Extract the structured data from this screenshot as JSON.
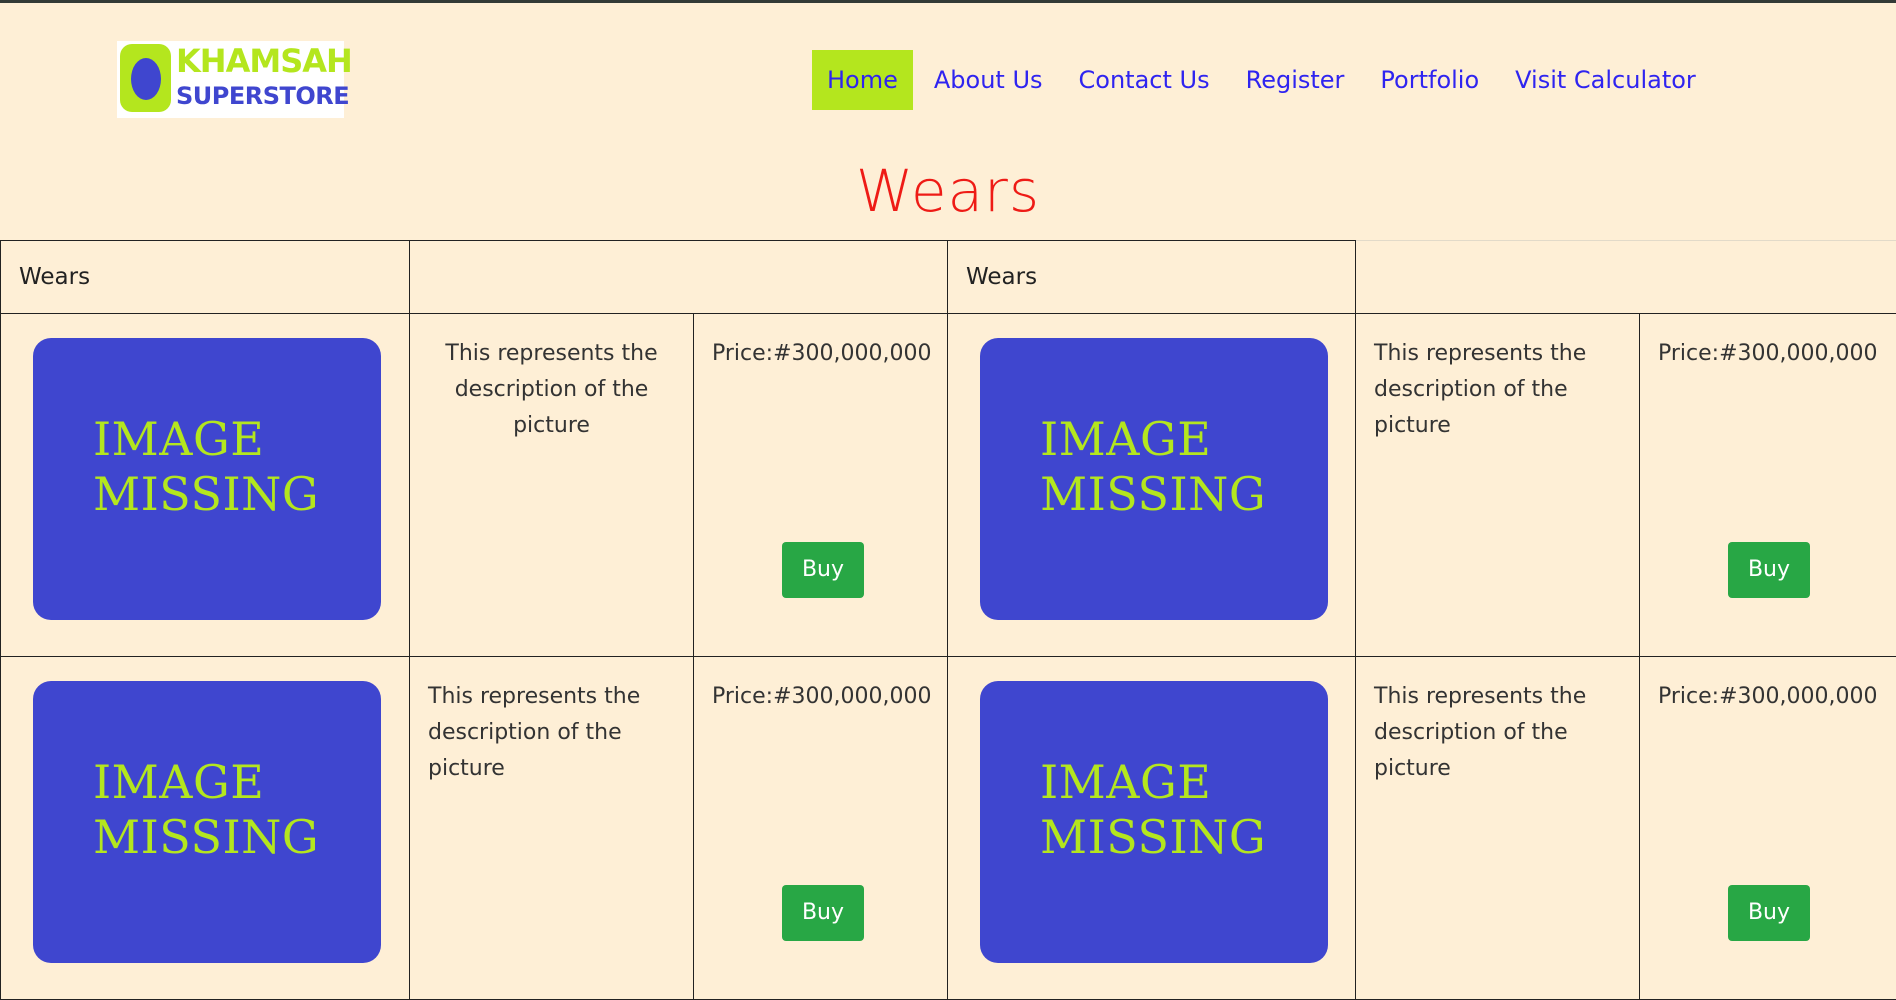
{
  "brand": {
    "name_top": "KHAMSAH",
    "name_bottom": "SUPERSTORE",
    "colors": {
      "lime": "#b4e61e",
      "blue": "#3f46cf"
    }
  },
  "nav": {
    "items": [
      {
        "label": "Home",
        "active": true
      },
      {
        "label": "About Us",
        "active": false
      },
      {
        "label": "Contact Us",
        "active": false
      },
      {
        "label": "Register",
        "active": false
      },
      {
        "label": "Portfolio",
        "active": false
      },
      {
        "label": "Visit Calculator",
        "active": false
      }
    ]
  },
  "page": {
    "heading": "Wears",
    "heading_color": "#ee1b16",
    "background": "#feefd6"
  },
  "table": {
    "headers": [
      "Wears",
      "",
      "Wears",
      ""
    ],
    "rows": [
      [
        {
          "image_text": "IMAGE\nMISSING",
          "description": "This represents the description of the picture",
          "price": "Price:#300,000,000",
          "buy_label": "Buy"
        },
        {
          "image_text": "IMAGE\nMISSING",
          "description": "This represents the description of the picture",
          "price": "Price:#300,000,000",
          "buy_label": "Buy"
        }
      ],
      [
        {
          "image_text": "IMAGE\nMISSING",
          "description": "This represents the description of the picture",
          "price": "Price:#300,000,000",
          "buy_label": "Buy"
        },
        {
          "image_text": "IMAGE\nMISSING",
          "description": "This represents the description of the picture",
          "price": "Price:#300,000,000",
          "buy_label": "Buy"
        }
      ]
    ]
  },
  "colors": {
    "nav_link": "#2f24f0",
    "nav_active_bg": "#b4e61e",
    "buy_button": "#28a745"
  }
}
